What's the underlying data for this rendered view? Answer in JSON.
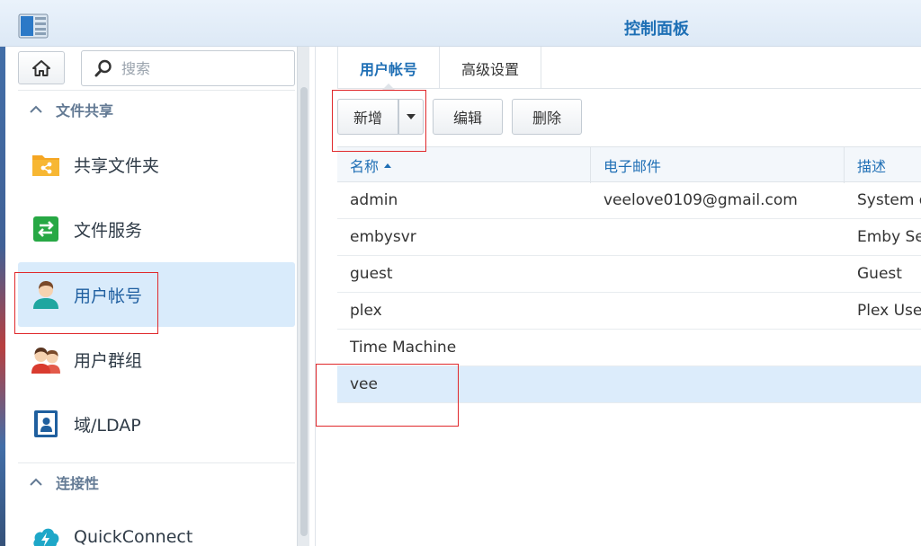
{
  "window": {
    "title": "控制面板"
  },
  "sidebar": {
    "search_placeholder": "搜索",
    "sections": [
      {
        "label": "文件共享"
      },
      {
        "label": "连接性"
      }
    ],
    "items": [
      {
        "label": "共享文件夹",
        "icon": "shared-folder-icon"
      },
      {
        "label": "文件服务",
        "icon": "file-services-icon"
      },
      {
        "label": "用户帐号",
        "icon": "user-account-icon",
        "active": true
      },
      {
        "label": "用户群组",
        "icon": "user-group-icon"
      },
      {
        "label": "域/LDAP",
        "icon": "domain-ldap-icon"
      },
      {
        "label": "QuickConnect",
        "icon": "quickconnect-icon"
      }
    ]
  },
  "tabs": [
    {
      "label": "用户帐号",
      "active": true
    },
    {
      "label": "高级设置"
    }
  ],
  "toolbar": {
    "add_label": "新增",
    "edit_label": "编辑",
    "delete_label": "删除"
  },
  "table": {
    "columns": [
      "名称",
      "电子邮件",
      "描述"
    ],
    "rows": [
      {
        "name": "admin",
        "email": "veelove0109@gmail.com",
        "desc": "System d"
      },
      {
        "name": "embysvr",
        "email": "",
        "desc": "Emby Se"
      },
      {
        "name": "guest",
        "email": "",
        "desc": "Guest"
      },
      {
        "name": "plex",
        "email": "",
        "desc": "Plex Use"
      },
      {
        "name": "Time Machine",
        "email": "",
        "desc": ""
      },
      {
        "name": "vee",
        "email": "",
        "desc": "",
        "selected": true
      }
    ]
  },
  "colors": {
    "accent": "#1f6fb5",
    "highlight": "#e0282b",
    "selected_row": "#dcecfb"
  }
}
